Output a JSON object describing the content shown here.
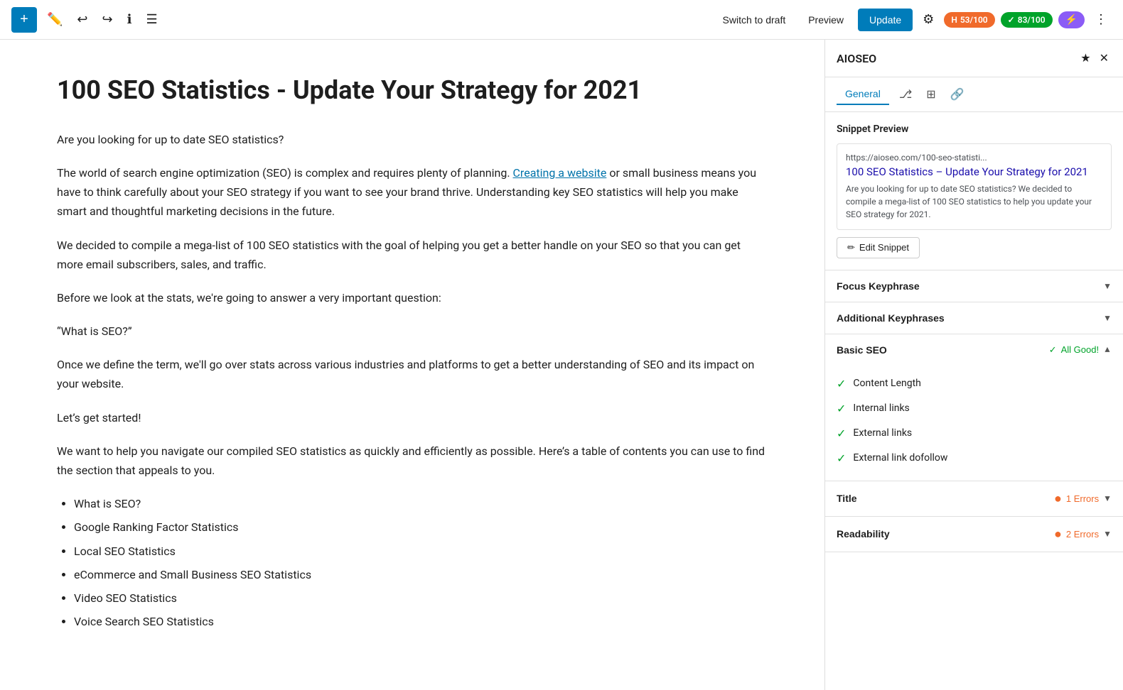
{
  "toolbar": {
    "add_label": "+",
    "switch_draft_label": "Switch to draft",
    "preview_label": "Preview",
    "update_label": "Update",
    "score_h_label": "H",
    "score_h_value": "53/100",
    "score_g_value": "83/100",
    "bolt_symbol": "⚡"
  },
  "editor": {
    "title": "100 SEO Statistics - Update Your Strategy for 2021",
    "paragraphs": [
      "Are you looking for up to date SEO statistics?",
      "The world of search engine optimization (SEO) is complex and requires plenty of planning. Creating a website or small business means you have to think carefully about your SEO strategy if you want to see your brand thrive. Understanding key SEO statistics will help you make smart and thoughtful marketing decisions in the future.",
      "We decided to compile a mega-list of 100 SEO statistics with the goal of helping you get a better handle on your SEO so that you can get more email subscribers, sales, and traffic.",
      "Before we look at the stats, we're going to answer a very important question:",
      "“What is SEO?”",
      "Once we define the term, we'll go over stats across various industries and platforms to get a better understanding of SEO and its impact on your website.",
      "Let’s get started!",
      "We want to help you navigate our compiled SEO statistics as quickly and efficiently as possible. Here’s a table of contents you can use to find the section that appeals to you."
    ],
    "link_text": "Creating a website",
    "list_items": [
      "What is SEO?",
      "Google Ranking Factor Statistics",
      "Local SEO Statistics",
      "eCommerce and Small Business SEO Statistics",
      "Video SEO Statistics",
      "Voice Search SEO Statistics"
    ]
  },
  "sidebar": {
    "title": "AIOSEO",
    "nav_tabs": [
      {
        "label": "General",
        "active": true
      },
      {
        "label": "share-icon",
        "type": "icon"
      },
      {
        "label": "table-icon",
        "type": "icon"
      },
      {
        "label": "link-icon",
        "type": "icon"
      }
    ],
    "snippet_preview": {
      "section_title": "Snippet Preview",
      "url": "https://aioseo.com/100-seo-statisti...",
      "headline": "100 SEO Statistics – Update Your Strategy for 2021",
      "description": "Are you looking for up to date SEO statistics? We decided to compile a mega-list of 100 SEO statistics to help you update your SEO strategy for 2021.",
      "edit_btn": "Edit Snippet"
    },
    "focus_keyphrase": {
      "label": "Focus Keyphrase",
      "status": ""
    },
    "additional_keyphrases": {
      "label": "Additional Keyphrases",
      "status": ""
    },
    "basic_seo": {
      "label": "Basic SEO",
      "status": "All Good!",
      "items": [
        "Content Length",
        "Internal links",
        "External links",
        "External link dofollow"
      ]
    },
    "title_section": {
      "label": "Title",
      "status": "1 Errors"
    },
    "readability": {
      "label": "Readability",
      "status": "2 Errors"
    }
  }
}
